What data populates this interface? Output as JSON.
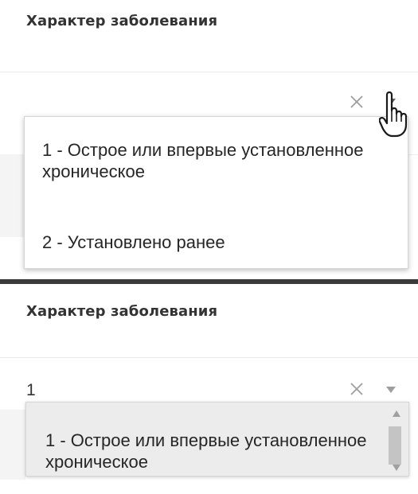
{
  "top_panel": {
    "title": "Характер заболевания",
    "field_value": "",
    "options": [
      "1 - Острое или впервые установленное хроническое",
      "2 - Установлено ранее"
    ]
  },
  "bottom_panel": {
    "title": "Характер заболевания",
    "field_value": "1",
    "options": [
      "1 - Острое или впервые установленное хроническое"
    ]
  },
  "icons": {
    "clear": "close-icon",
    "toggle": "caret-down-icon",
    "cursor": "pointer-hand-icon"
  },
  "colors": {
    "divider": "#3a3a3a",
    "dropdown_border": "#d6d6d6",
    "highlight_bg": "#ececec",
    "scroll_thumb": "#c4c4c4",
    "icon_grey": "#9e9e9e"
  }
}
